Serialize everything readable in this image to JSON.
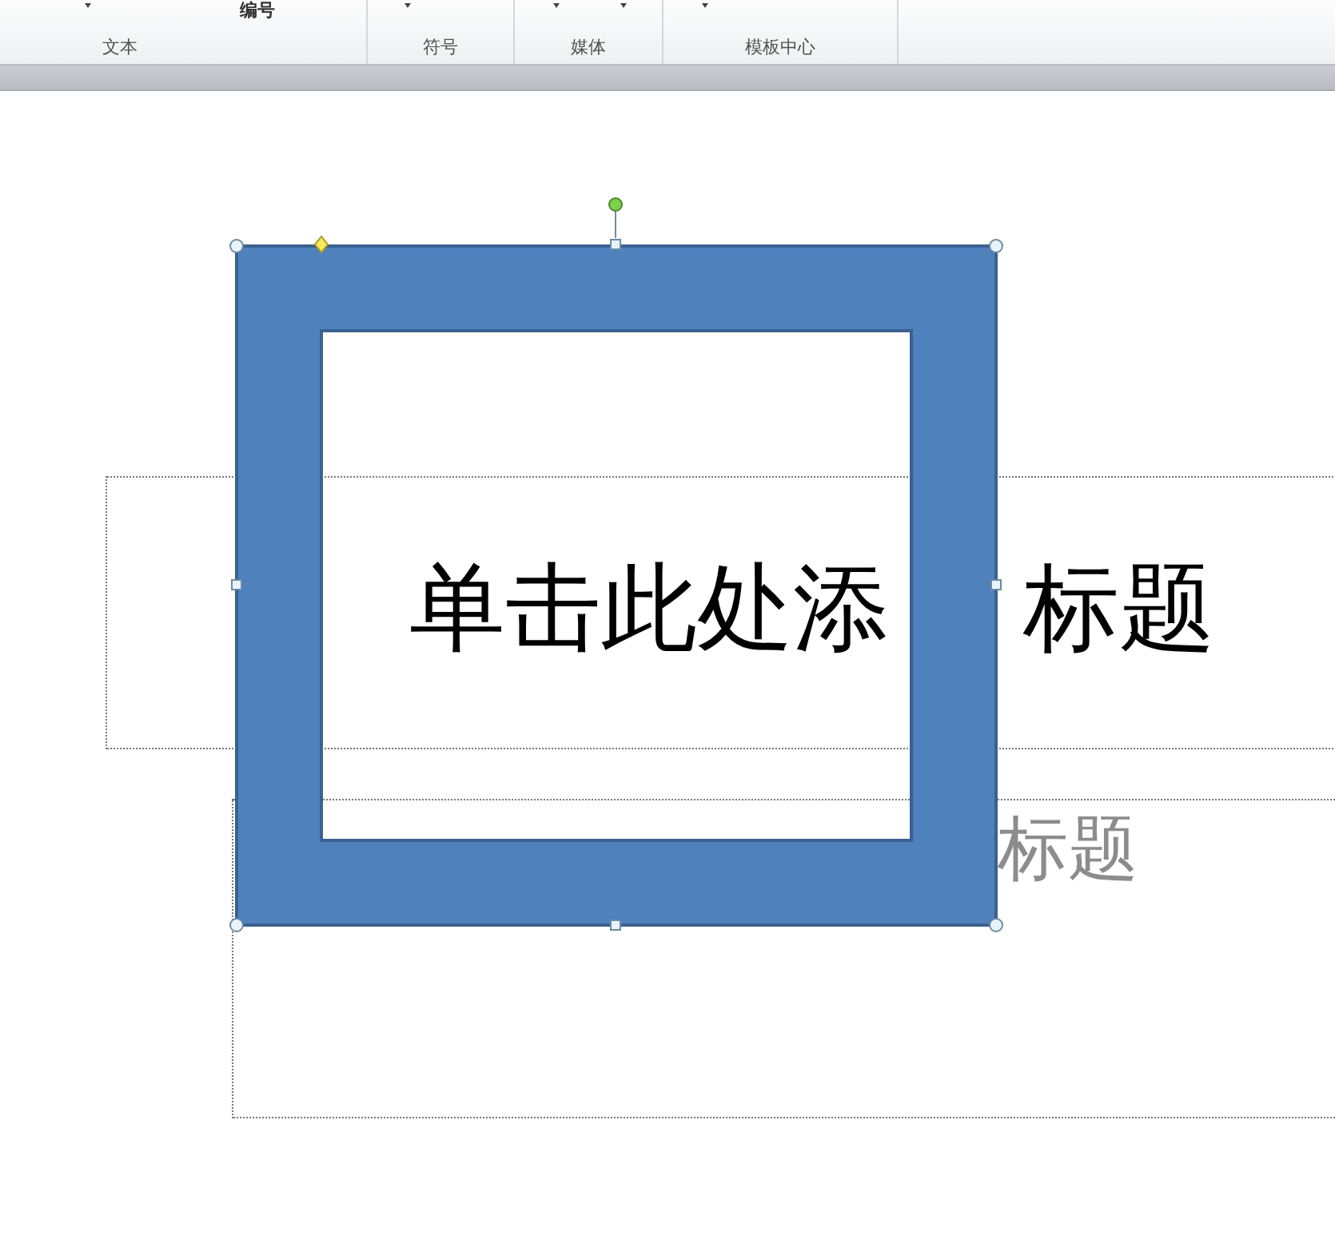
{
  "ribbon": {
    "top_label": "编号",
    "groups": [
      {
        "label": "文本"
      },
      {
        "label": "符号"
      },
      {
        "label": "媒体"
      },
      {
        "label": "模板中心"
      }
    ]
  },
  "slide": {
    "title_placeholder": {
      "visible_texts": [
        "单击此处添",
        "标题"
      ]
    },
    "subtitle_placeholder": {
      "visible_texts": [
        "标题"
      ]
    },
    "shape": {
      "kind": "frame",
      "selected": true
    }
  }
}
